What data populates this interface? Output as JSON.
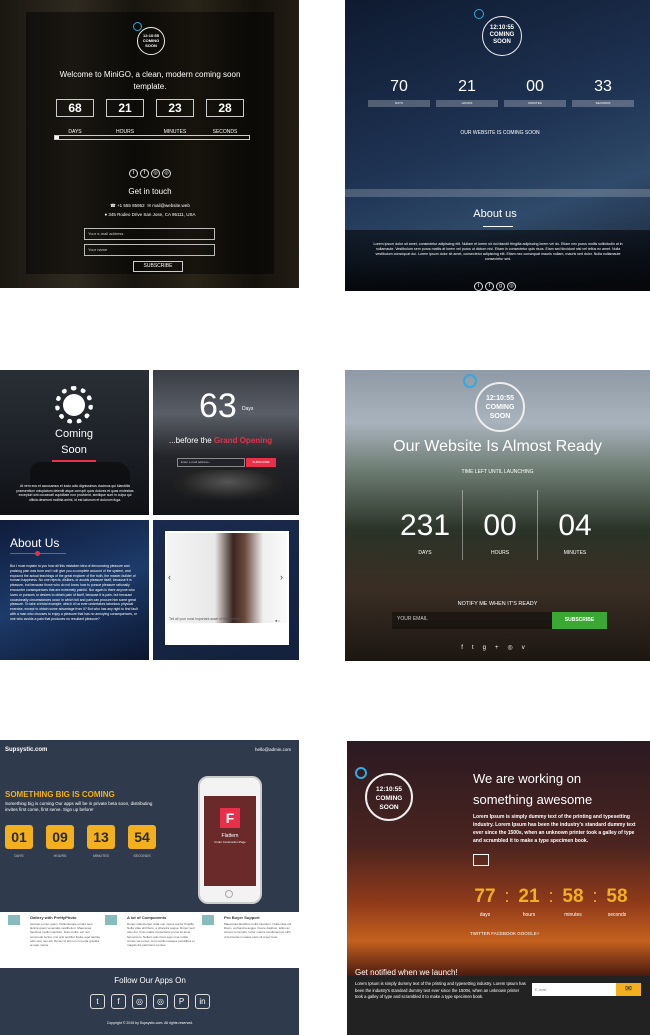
{
  "t1": {
    "clock": "12:10:55",
    "coming": "COMING",
    "soon": "SOON",
    "welcome": "Welcome to MiniGO, a clean, modern coming soon template.",
    "count": [
      {
        "v": "68",
        "l": "DAYS"
      },
      {
        "v": "21",
        "l": "HOURS"
      },
      {
        "v": "23",
        "l": "MINUTES"
      },
      {
        "v": "28",
        "l": "SECONDS"
      }
    ],
    "progress": 0.02,
    "social": [
      "t",
      "f",
      "◎",
      "◎"
    ],
    "get_in_touch": "Get in touch",
    "phone": "+1 555 85952",
    "email": "mail@website.web",
    "address": "345 Rodeo Drive San Jose, CA 95111, USA",
    "email_ph": "Your e-mail address",
    "name_ph": "Your name",
    "subscribe": "SUBSCRIBE"
  },
  "t2": {
    "clock": "12:10:55",
    "coming": "COMING",
    "soon": "SOON",
    "count": [
      {
        "v": "70",
        "l": "DAYS"
      },
      {
        "v": "21",
        "l": "HOURS"
      },
      {
        "v": "00",
        "l": "MINUTES"
      },
      {
        "v": "33",
        "l": "SECONDS"
      }
    ],
    "tagline": "OUR WEBSITE IS COMING SOON",
    "about": "About us",
    "body": "Lorem ipsum dolor sit amet, consectetur adipiscing elit. Nullam et lorem sit dui blandit fringilla adipiscing lorem vel do. Etiam nec purus mollis sollicitudin at in nullamaute. Vestibulum sem purus mattis at lorem vel purus ut dictum nisi. Etiam in consectetur quis risus. Eiam sed tincidunt nisl vel tellus ex amet. Nulla vestibulum consequat dui. Lorem ipsum dolor sit amet, consectetur adipiscing elit. Etiam nec consequat mauris nullam, mauris sed dolor. Nulla nullamaute consectetur sed.",
    "social": [
      "t",
      "f",
      "g",
      "◎"
    ]
  },
  "t3": {
    "coming": "Coming",
    "soon": "Soon",
    "body": "At vero eos et accusamus et iusto odio dignissimos ducimus qui blanditiis praesentium voluptatum deleniti atque corrupti quos dolores et quas molestias excepturi sint occaecati cupiditate non provident, similique sunt in culpa qui officia deserunt mollitia animi, id est laborum et dolorum fuga."
  },
  "t4": {
    "num": "63",
    "days": "Days",
    "before": "...before the ",
    "grand": "Grand Opening",
    "email_ph": "Enter e-mail address...",
    "subscribe": "SUBSCRIBE"
  },
  "t5": {
    "title": "About Us",
    "body": "But I must explain to you how all this mistaken idea of denouncing pleasure and praising pain was born and I will give you a complete account of the system, and expound the actual teachings of the great explorer of the truth, the master-builder of human happiness. No one rejects, dislikes, or avoids pleasure itself, because it is pleasure, but because those who do not know how to pursue pleasure rationally encounter consequences that are extremely painful. Nor again is there anyone who loves or pursues or desires to obtain pain of itself, because it is pain, but because occasionally circumstances occur in which toil and pain can procure him some great pleasure. To take a trivial example, which of us ever undertakes laborious physical exercise, except to obtain some advantage from it? But who has any right to find fault with a man who chooses to enjoy a pleasure that has no annoying consequences, or one who avoids a pain that produces no resultant pleasure?"
  },
  "t6": {
    "caption": "Tell all your most important asset of the website"
  },
  "t7": {
    "clock": "12:10:55",
    "coming": "COMING",
    "soon": "SOON",
    "title": "Our Website Is Almost Ready",
    "sub": "TIME LEFT UNTIL LAUNCHING",
    "count": [
      {
        "v": "231",
        "l": "DAYS"
      },
      {
        "v": "00",
        "l": "HOURS"
      },
      {
        "v": "04",
        "l": "MINUTES"
      }
    ],
    "notify": "NOTIFY ME WHEN IT'S READY",
    "email_ph": "YOUR EMAIL",
    "subscribe": "SUBSCRIBE",
    "social": [
      "f",
      "t",
      "g+",
      "◎",
      "v"
    ]
  },
  "t8": {
    "brand": "Supsystic.com",
    "mail": "hello@admin.com",
    "headline": "SOMETHING BIG IS COMING",
    "sub": "Something big is coming Our apps will be in private beta soon, distributing invites first come, first serve. Sign up before!",
    "count": [
      {
        "v": "01",
        "l": "DAYS"
      },
      {
        "v": "09",
        "l": "HOURS"
      },
      {
        "v": "13",
        "l": "MINUTES"
      },
      {
        "v": "54",
        "l": "SECONDS"
      }
    ],
    "phone_letter": "F",
    "phone_title": "Flattern",
    "phone_sub": "Under Construction Page",
    "features": [
      {
        "title": "Gallery with PrettyPhoto",
        "body": "Aenean eu leo quam. Pellentesque ornare sem lacinia quam venenatis vestibulum. Maecenas faucibus mollis interdum. Duis mollis, est non commodo luctus, nisi erat porttitor ligula, eget lacinia odio sem nec elit. Donec id elit non mi porta gravida at eget metus."
      },
      {
        "title": "A lot of Components",
        "body": "Donec ullamcorper nulla non metus auctor fringilla. Nulla vitae elit libero, a pharetra augue. Donec sed odio dui. Cras mattis consectetur purus sit amet fermentum. Nullam quis risus eget urna mollis ornare vel eu leo. Cum sociis natoque penatibus et magnis dis parturient montes."
      },
      {
        "title": "Pro Buyer Support",
        "body": "Maecenas faucibus mollis interdum. Nulla vitae elit libero, a pharetra augue. Fusce dapibus, tellus ac cursus commodo, tortor mauris condimentum nibh, ut fermentum massa justo sit amet risus."
      }
    ],
    "follow": "Follow Our Apps On",
    "social": [
      "t",
      "f",
      "◎",
      "◎",
      "P",
      "in"
    ],
    "copyright": "Copyright © 2015 by Supsystic.com. All rights reserved."
  },
  "t9": {
    "clock": "12:10:55",
    "coming": "COMING",
    "soon": "SOON",
    "h1": "We are working on",
    "h2": "something awesome",
    "body": "Lorem Ipsum is simply dummy text of the printing and typesetting industry. Lorem Ipsum has been the industry's standard dummy text ever since the 1500s, when an unknown printer took a galley of type and scrambled it to make a type specimen book.",
    "count": [
      {
        "v": "77",
        "l": "days"
      },
      {
        "v": "21",
        "l": "hours"
      },
      {
        "v": "58",
        "l": "minutes"
      },
      {
        "v": "58",
        "l": "seconds"
      }
    ],
    "social": "TWITTER FACEBOOK GOOGLE+",
    "notified": "Get notified when we launch!",
    "nbody": "Lorem Ipsum is simply dummy text of the printing and typesetting industry. Lorem Ipsum has been the industry's standard dummy text ever since the 1500s, when an unknown printer took a galley of type and scrambled it to make a type specimen book.",
    "email_ph": "E-mail"
  },
  "colors": {
    "accent_red": "#e8304a",
    "green": "#3aa832",
    "orange": "#f2b01e",
    "react": "#33aadd"
  }
}
